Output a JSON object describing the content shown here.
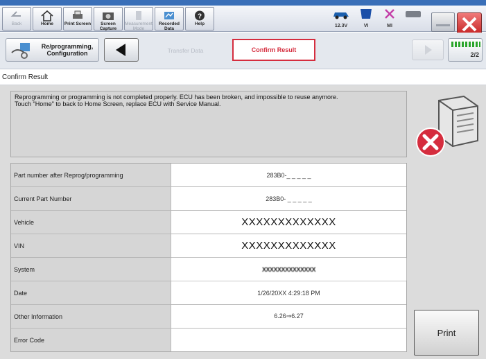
{
  "toolbar": {
    "back": "Back",
    "home": "Home",
    "print_screen": "Print Screen",
    "screen_capture": "Screen Capture",
    "measurement_mode": "Measurement Mode",
    "recorded_data": "Recorded Data",
    "help": "Help",
    "battery": "12.3V",
    "vi": "VI",
    "mi": "MI"
  },
  "nav": {
    "reprogramming": "Re/programming, Configuration",
    "transfer_data": "Transfer Data",
    "confirm_result": "Confirm Result",
    "page_indicator": "2/2"
  },
  "page": {
    "title": "Confirm Result",
    "message_line1": "Reprogramming or programming is not completed properly. ECU has been broken, and impossible to reuse anymore.",
    "message_line2": "Touch \"Home\" to back to Home Screen, replace ECU with Service Manual."
  },
  "table": [
    {
      "label": "Part number after Reprog/programming",
      "value": "283B0-_ _ _ _ _"
    },
    {
      "label": "Current Part Number",
      "value": "283B0- _ _ _ _ _"
    },
    {
      "label": "Vehicle",
      "value": "XXXXXXXXXXXXX"
    },
    {
      "label": "VIN",
      "value": "XXXXXXXXXXXXX"
    },
    {
      "label": "System",
      "value": "XXXXXXXXXXXXXX"
    },
    {
      "label": "Date",
      "value": "1/26/20XX 4:29:18 PM"
    },
    {
      "label": "Other Information",
      "value": "6.26⇒6.27"
    },
    {
      "label": "Error Code",
      "value": ""
    }
  ],
  "buttons": {
    "print": "Print"
  },
  "colors": {
    "accent_red": "#d52d3e",
    "title_blue": "#3a6fb8",
    "progress_green": "#2aa52a"
  }
}
